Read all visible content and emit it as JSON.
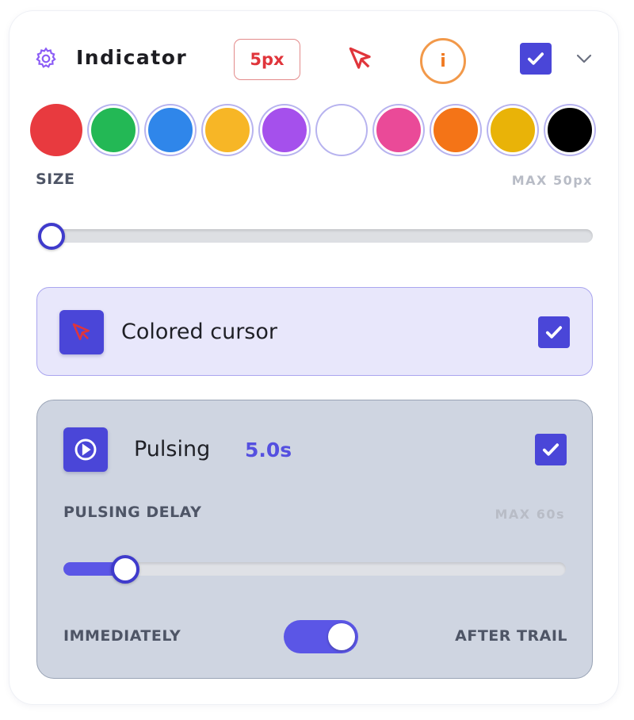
{
  "header": {
    "title": "Indicator",
    "size_badge": "5px",
    "info_label": "i",
    "enabled": true
  },
  "swatches": [
    {
      "name": "red",
      "color": "#e83a3f"
    },
    {
      "name": "green",
      "color": "#23b855"
    },
    {
      "name": "blue",
      "color": "#2f86ea"
    },
    {
      "name": "yellow",
      "color": "#f7b626"
    },
    {
      "name": "purple",
      "color": "#a550ec"
    },
    {
      "name": "white",
      "color": "#ffffff"
    },
    {
      "name": "pink",
      "color": "#ea4a98"
    },
    {
      "name": "orange",
      "color": "#f47417"
    },
    {
      "name": "gold",
      "color": "#e9b308"
    },
    {
      "name": "black",
      "color": "#000000"
    }
  ],
  "size": {
    "label": "SIZE",
    "max_label": "MAX 50px",
    "value_fraction": 0.0
  },
  "colored_cursor": {
    "label": "Colored cursor",
    "checked": true,
    "icon": "cursor-arrow-icon"
  },
  "pulsing": {
    "label": "Pulsing",
    "value": "5.0s",
    "checked": true,
    "icon": "play-circle-icon",
    "delay_label": "PULSING DELAY",
    "delay_max_label": "MAX 60s",
    "delay_fraction": 0.09,
    "mode_left": "IMMEDIATELY",
    "mode_right": "AFTER TRAIL",
    "mode_after_trail": true
  },
  "colors": {
    "accent": "#4a46d8",
    "badge_red": "#e0353b",
    "info_orange": "#f07a22"
  }
}
